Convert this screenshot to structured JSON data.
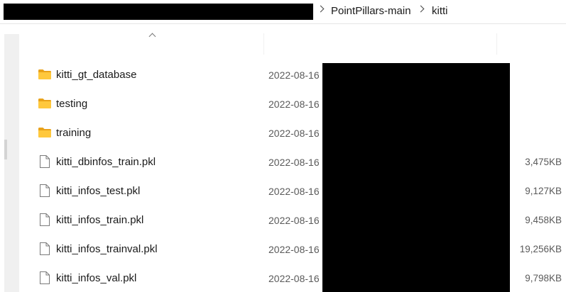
{
  "breadcrumb": {
    "items": [
      "PointPillars-main",
      "kitti"
    ]
  },
  "header": {
    "sort_direction": "ascending"
  },
  "files": [
    {
      "name": "kitti_gt_database",
      "date": "2022-08-16",
      "size": "",
      "icon": "folder-icon"
    },
    {
      "name": "testing",
      "date": "2022-08-16",
      "size": "",
      "icon": "folder-icon"
    },
    {
      "name": "training",
      "date": "2022-08-16",
      "size": "",
      "icon": "folder-icon"
    },
    {
      "name": "kitti_dbinfos_train.pkl",
      "date": "2022-08-16",
      "size": "3,475KB",
      "icon": "file-icon"
    },
    {
      "name": "kitti_infos_test.pkl",
      "date": "2022-08-16",
      "size": "9,127KB",
      "icon": "file-icon"
    },
    {
      "name": "kitti_infos_train.pkl",
      "date": "2022-08-16",
      "size": "9,458KB",
      "icon": "file-icon"
    },
    {
      "name": "kitti_infos_trainval.pkl",
      "date": "2022-08-16",
      "size": "19,256KB",
      "icon": "file-icon"
    },
    {
      "name": "kitti_infos_val.pkl",
      "date": "2022-08-16",
      "size": "9,798KB",
      "icon": "file-icon"
    }
  ],
  "colors": {
    "folder": "#ffc83d",
    "folder_dark": "#e9a21a",
    "redaction": "#000000"
  }
}
